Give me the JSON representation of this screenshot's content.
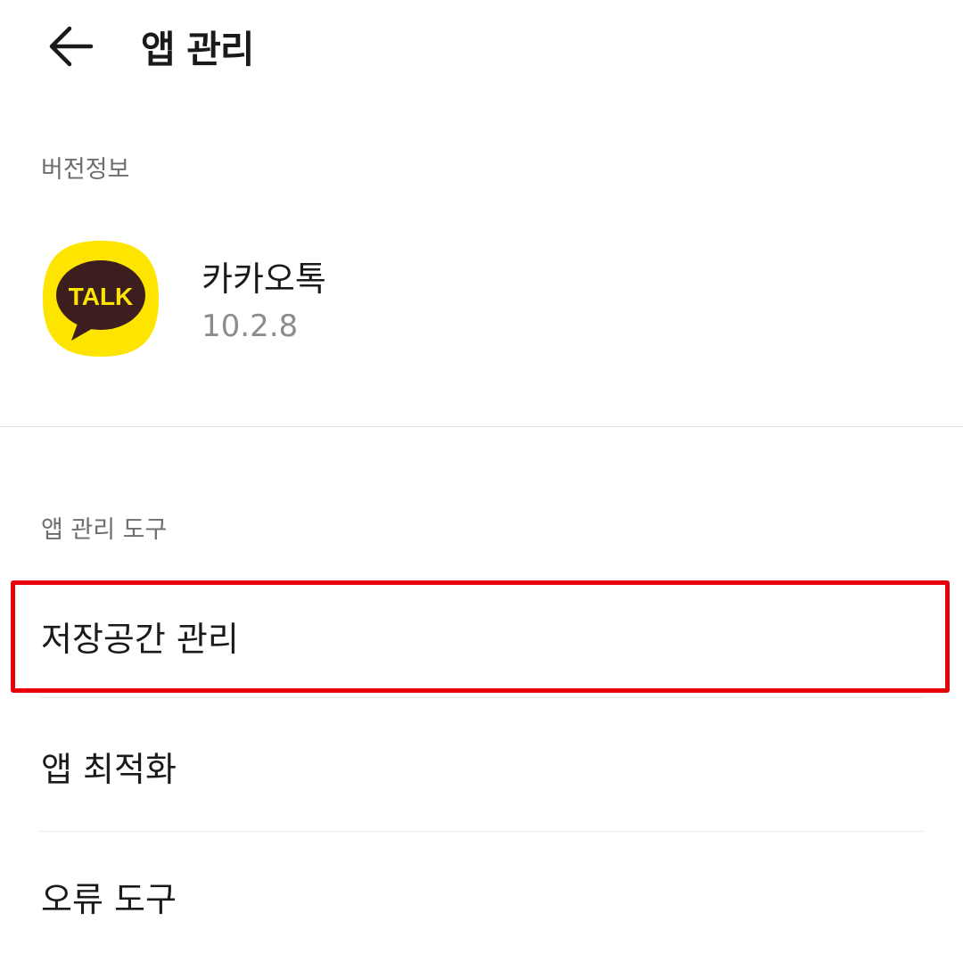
{
  "header": {
    "back_icon": "arrow-left-icon",
    "title": "앱 관리"
  },
  "version_section": {
    "label": "버전정보",
    "app": {
      "icon": "kakaotalk-app-icon",
      "icon_text": "TALK",
      "name": "카카오톡",
      "version": "10.2.8"
    }
  },
  "tools_section": {
    "label": "앱 관리 도구",
    "items": [
      {
        "label": "저장공간 관리",
        "highlighted": true
      },
      {
        "label": "앱 최적화"
      },
      {
        "label": "오류 도구"
      }
    ]
  },
  "colors": {
    "highlight": "#e8000b",
    "kakao_yellow": "#FEE500",
    "kakao_brown": "#3C1E1E"
  }
}
